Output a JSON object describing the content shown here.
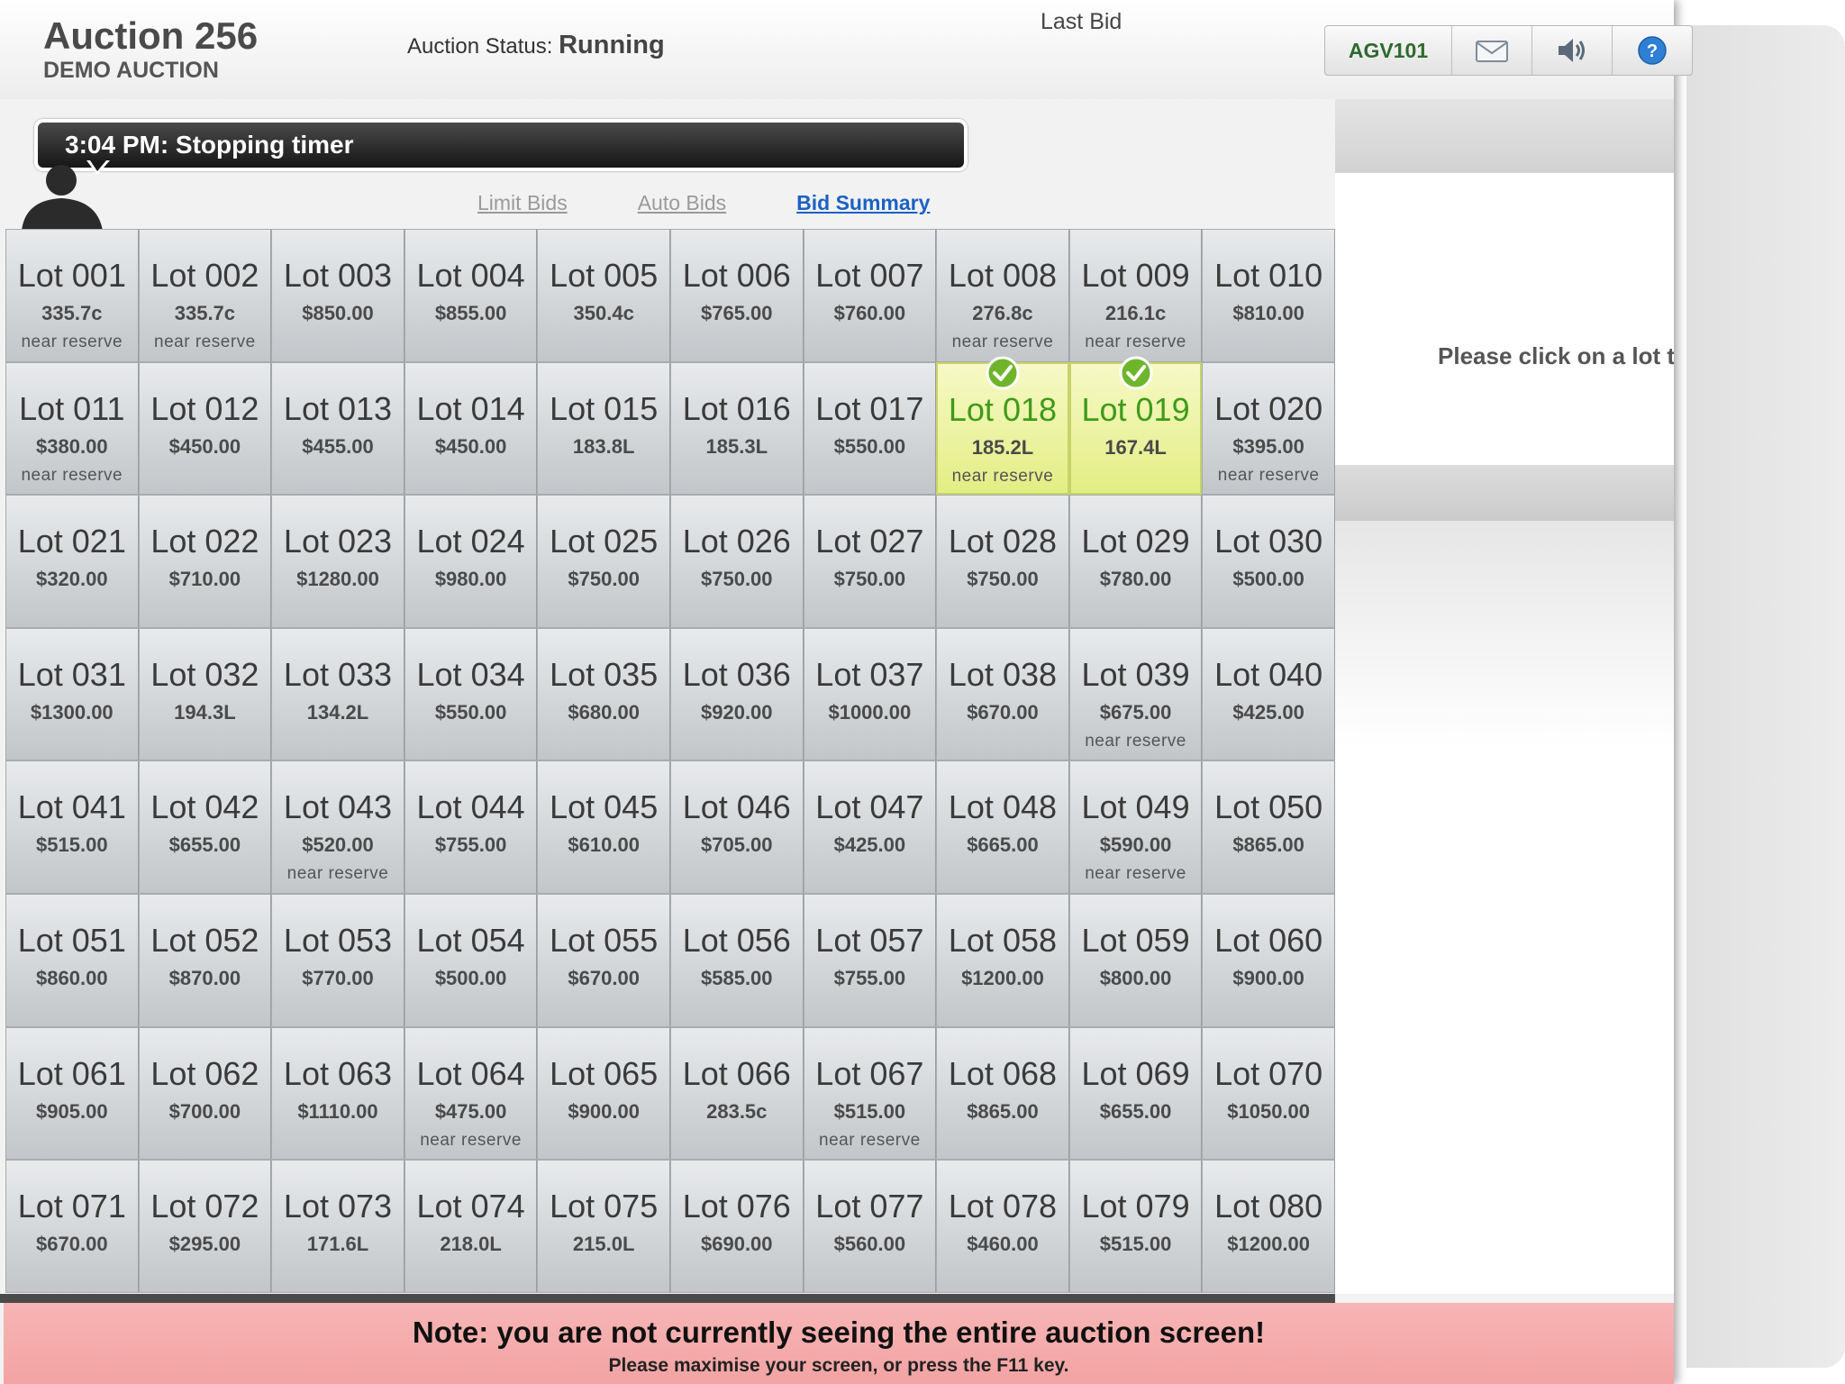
{
  "header": {
    "title": "Auction 256",
    "subtitle": "DEMO AUCTION",
    "status_label": "Auction Status: ",
    "status_value": "Running",
    "last_bid_label": "Last Bid"
  },
  "toolbar": {
    "user_label": "AGV101",
    "icons": [
      "mail-icon",
      "speaker-icon",
      "help-icon"
    ]
  },
  "message": {
    "text": "3:04 PM: Stopping timer"
  },
  "tabs": [
    {
      "label": "Limit Bids",
      "active": false
    },
    {
      "label": "Auto Bids",
      "active": false
    },
    {
      "label": "Bid Summary",
      "active": true
    }
  ],
  "right_panel": {
    "hint": "Please click on a lot to"
  },
  "colors": {
    "winning_lot": "#e8f29a",
    "winning_text": "#3e9a1b",
    "link": "#1a62c4",
    "note_bg": "#f5aeae"
  },
  "lots": [
    {
      "name": "Lot 001",
      "price": "335.7c",
      "reserve": "near reserve"
    },
    {
      "name": "Lot 002",
      "price": "335.7c",
      "reserve": "near reserve"
    },
    {
      "name": "Lot 003",
      "price": "$850.00",
      "reserve": ""
    },
    {
      "name": "Lot 004",
      "price": "$855.00",
      "reserve": ""
    },
    {
      "name": "Lot 005",
      "price": "350.4c",
      "reserve": ""
    },
    {
      "name": "Lot 006",
      "price": "$765.00",
      "reserve": ""
    },
    {
      "name": "Lot 007",
      "price": "$760.00",
      "reserve": ""
    },
    {
      "name": "Lot 008",
      "price": "276.8c",
      "reserve": "near reserve"
    },
    {
      "name": "Lot 009",
      "price": "216.1c",
      "reserve": "near reserve"
    },
    {
      "name": "Lot 010",
      "price": "$810.00",
      "reserve": ""
    },
    {
      "name": "Lot 011",
      "price": "$380.00",
      "reserve": "near reserve"
    },
    {
      "name": "Lot 012",
      "price": "$450.00",
      "reserve": ""
    },
    {
      "name": "Lot 013",
      "price": "$455.00",
      "reserve": ""
    },
    {
      "name": "Lot 014",
      "price": "$450.00",
      "reserve": ""
    },
    {
      "name": "Lot 015",
      "price": "183.8L",
      "reserve": ""
    },
    {
      "name": "Lot 016",
      "price": "185.3L",
      "reserve": ""
    },
    {
      "name": "Lot 017",
      "price": "$550.00",
      "reserve": ""
    },
    {
      "name": "Lot 018",
      "price": "185.2L",
      "reserve": "near reserve",
      "winning": true
    },
    {
      "name": "Lot 019",
      "price": "167.4L",
      "reserve": "",
      "winning": true
    },
    {
      "name": "Lot 020",
      "price": "$395.00",
      "reserve": "near reserve"
    },
    {
      "name": "Lot 021",
      "price": "$320.00",
      "reserve": ""
    },
    {
      "name": "Lot 022",
      "price": "$710.00",
      "reserve": ""
    },
    {
      "name": "Lot 023",
      "price": "$1280.00",
      "reserve": ""
    },
    {
      "name": "Lot 024",
      "price": "$980.00",
      "reserve": ""
    },
    {
      "name": "Lot 025",
      "price": "$750.00",
      "reserve": ""
    },
    {
      "name": "Lot 026",
      "price": "$750.00",
      "reserve": ""
    },
    {
      "name": "Lot 027",
      "price": "$750.00",
      "reserve": ""
    },
    {
      "name": "Lot 028",
      "price": "$750.00",
      "reserve": ""
    },
    {
      "name": "Lot 029",
      "price": "$780.00",
      "reserve": ""
    },
    {
      "name": "Lot 030",
      "price": "$500.00",
      "reserve": ""
    },
    {
      "name": "Lot 031",
      "price": "$1300.00",
      "reserve": ""
    },
    {
      "name": "Lot 032",
      "price": "194.3L",
      "reserve": ""
    },
    {
      "name": "Lot 033",
      "price": "134.2L",
      "reserve": ""
    },
    {
      "name": "Lot 034",
      "price": "$550.00",
      "reserve": ""
    },
    {
      "name": "Lot 035",
      "price": "$680.00",
      "reserve": ""
    },
    {
      "name": "Lot 036",
      "price": "$920.00",
      "reserve": ""
    },
    {
      "name": "Lot 037",
      "price": "$1000.00",
      "reserve": ""
    },
    {
      "name": "Lot 038",
      "price": "$670.00",
      "reserve": ""
    },
    {
      "name": "Lot 039",
      "price": "$675.00",
      "reserve": "near reserve"
    },
    {
      "name": "Lot 040",
      "price": "$425.00",
      "reserve": ""
    },
    {
      "name": "Lot 041",
      "price": "$515.00",
      "reserve": ""
    },
    {
      "name": "Lot 042",
      "price": "$655.00",
      "reserve": ""
    },
    {
      "name": "Lot 043",
      "price": "$520.00",
      "reserve": "near reserve"
    },
    {
      "name": "Lot 044",
      "price": "$755.00",
      "reserve": ""
    },
    {
      "name": "Lot 045",
      "price": "$610.00",
      "reserve": ""
    },
    {
      "name": "Lot 046",
      "price": "$705.00",
      "reserve": ""
    },
    {
      "name": "Lot 047",
      "price": "$425.00",
      "reserve": ""
    },
    {
      "name": "Lot 048",
      "price": "$665.00",
      "reserve": ""
    },
    {
      "name": "Lot 049",
      "price": "$590.00",
      "reserve": "near reserve"
    },
    {
      "name": "Lot 050",
      "price": "$865.00",
      "reserve": ""
    },
    {
      "name": "Lot 051",
      "price": "$860.00",
      "reserve": ""
    },
    {
      "name": "Lot 052",
      "price": "$870.00",
      "reserve": ""
    },
    {
      "name": "Lot 053",
      "price": "$770.00",
      "reserve": ""
    },
    {
      "name": "Lot 054",
      "price": "$500.00",
      "reserve": ""
    },
    {
      "name": "Lot 055",
      "price": "$670.00",
      "reserve": ""
    },
    {
      "name": "Lot 056",
      "price": "$585.00",
      "reserve": ""
    },
    {
      "name": "Lot 057",
      "price": "$755.00",
      "reserve": ""
    },
    {
      "name": "Lot 058",
      "price": "$1200.00",
      "reserve": ""
    },
    {
      "name": "Lot 059",
      "price": "$800.00",
      "reserve": ""
    },
    {
      "name": "Lot 060",
      "price": "$900.00",
      "reserve": ""
    },
    {
      "name": "Lot 061",
      "price": "$905.00",
      "reserve": ""
    },
    {
      "name": "Lot 062",
      "price": "$700.00",
      "reserve": ""
    },
    {
      "name": "Lot 063",
      "price": "$1110.00",
      "reserve": ""
    },
    {
      "name": "Lot 064",
      "price": "$475.00",
      "reserve": "near reserve"
    },
    {
      "name": "Lot 065",
      "price": "$900.00",
      "reserve": ""
    },
    {
      "name": "Lot 066",
      "price": "283.5c",
      "reserve": ""
    },
    {
      "name": "Lot 067",
      "price": "$515.00",
      "reserve": "near reserve"
    },
    {
      "name": "Lot 068",
      "price": "$865.00",
      "reserve": ""
    },
    {
      "name": "Lot 069",
      "price": "$655.00",
      "reserve": ""
    },
    {
      "name": "Lot 070",
      "price": "$1050.00",
      "reserve": ""
    },
    {
      "name": "Lot 071",
      "price": "$670.00",
      "reserve": ""
    },
    {
      "name": "Lot 072",
      "price": "$295.00",
      "reserve": ""
    },
    {
      "name": "Lot 073",
      "price": "171.6L",
      "reserve": ""
    },
    {
      "name": "Lot 074",
      "price": "218.0L",
      "reserve": ""
    },
    {
      "name": "Lot 075",
      "price": "215.0L",
      "reserve": ""
    },
    {
      "name": "Lot 076",
      "price": "$690.00",
      "reserve": ""
    },
    {
      "name": "Lot 077",
      "price": "$560.00",
      "reserve": ""
    },
    {
      "name": "Lot 078",
      "price": "$460.00",
      "reserve": ""
    },
    {
      "name": "Lot 079",
      "price": "$515.00",
      "reserve": ""
    },
    {
      "name": "Lot 080",
      "price": "$1200.00",
      "reserve": ""
    }
  ],
  "note": {
    "line1": "Note: you are not currently seeing the entire auction screen!",
    "line2": "Please maximise your screen, or press the F11 key."
  }
}
